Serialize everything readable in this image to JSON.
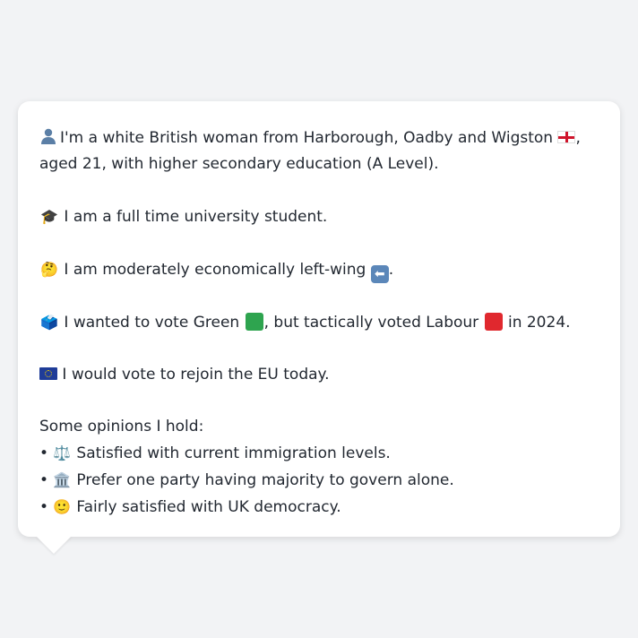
{
  "profile": {
    "line1": "I'm a white British woman from Harborough, Oadby and Wigston",
    "line1_end": ",",
    "line2": "aged 21, with higher secondary education (A Level).",
    "occupation": "I am a full time university student.",
    "economic_pre": "I am moderately economically left-wing",
    "economic_post": ".",
    "vote_a": "I wanted to vote Green",
    "vote_b": ", but tactically voted Labour",
    "vote_c": "in 2024.",
    "eu": "I would vote to rejoin the EU today."
  },
  "opinions": {
    "heading": "Some opinions I hold:",
    "bullet": "•",
    "items": [
      {
        "icon": "⚖️",
        "text": "Satisfied with current immigration levels."
      },
      {
        "icon": "🏛️",
        "text": "Prefer one party having majority to govern alone."
      },
      {
        "icon": "🙂",
        "text": "Fairly satisfied with UK democracy."
      }
    ]
  },
  "icons": {
    "grad_cap": "🎓",
    "thinking": "🤔",
    "ballot": "🗳️",
    "arrow_left": "⬅"
  },
  "colors": {
    "green_party": "#2ea44f",
    "labour": "#e0282e",
    "eu_blue": "#1f3c98",
    "england_red": "#cf142b"
  }
}
